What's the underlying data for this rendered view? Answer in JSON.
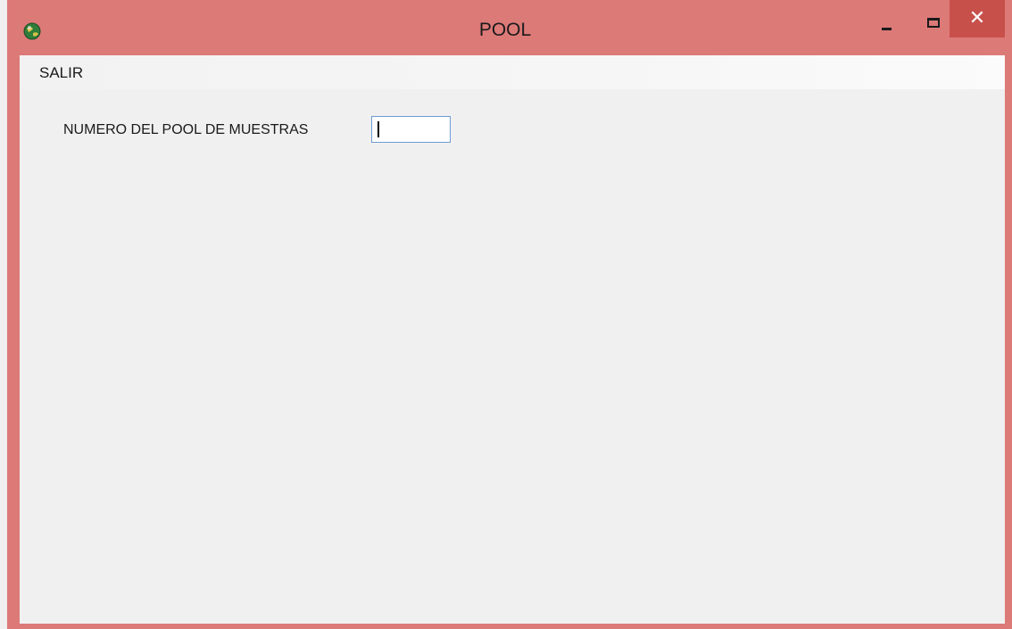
{
  "window": {
    "title": "POOL",
    "icon": "globe-app-icon",
    "controls": {
      "minimize": "minimize-icon",
      "maximize": "maximize-icon",
      "close_glyph": "✕"
    },
    "accent_color": "#dc7a78",
    "close_color": "#c7504b"
  },
  "menu": {
    "items": [
      {
        "label": "SALIR"
      }
    ]
  },
  "form": {
    "pool_number": {
      "label": "NUMERO DEL POOL DE MUESTRAS",
      "value": ""
    }
  }
}
